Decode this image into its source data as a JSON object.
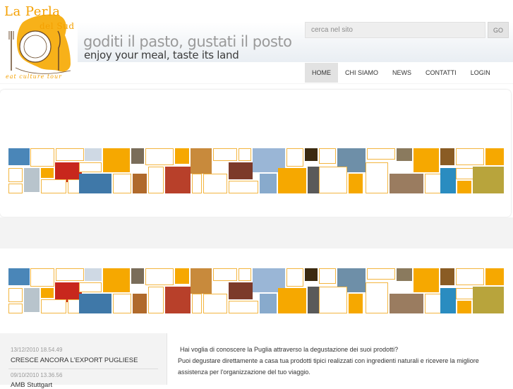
{
  "logo": {
    "line1": "La Perla",
    "line2": "del Sud",
    "line3": "eat culture tour"
  },
  "header": {
    "tagline_it": "goditi il pasto, gustati il posto",
    "tagline_en": "enjoy your meal, taste its land"
  },
  "search": {
    "placeholder": "cerca nel sito",
    "button_label": "GO"
  },
  "nav": {
    "items": [
      {
        "label": "HOME",
        "active": true
      },
      {
        "label": "CHI SIAMO",
        "active": false
      },
      {
        "label": "NEWS",
        "active": false
      },
      {
        "label": "CONTATTI",
        "active": false
      },
      {
        "label": "LOGIN",
        "active": false
      }
    ]
  },
  "news": [
    {
      "date": "13/12/2010 18.54.49",
      "title": "CRESCE ANCORA L'EXPORT PUGLIESE"
    },
    {
      "date": "09/10/2010 13.36.56",
      "title": "AMB Stuttgart"
    }
  ],
  "intro": {
    "line1": "Hai voglia di conoscere la Puglia  attraverso la degustazione dei suoi prodotti?",
    "line2": "Puoi degustare direttamente a casa tua prodotti tipici realizzati con ingredienti naturali e ricevere la migliore",
    "line3": "assistenza per l'organizzazione del tuo viaggio."
  },
  "colors": {
    "brand_orange": "#f6a800",
    "tile_outline": "#f3b540"
  }
}
